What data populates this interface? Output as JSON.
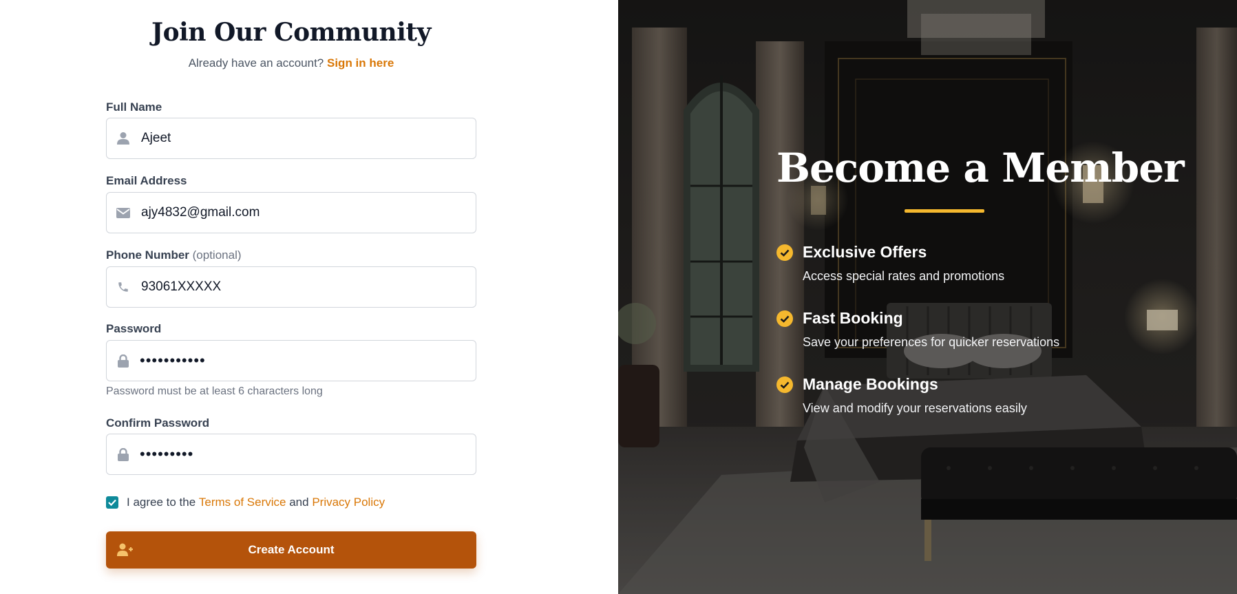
{
  "signup": {
    "title": "Join Our Community",
    "already_text": "Already have an account? ",
    "signin_link": "Sign in here"
  },
  "fields": {
    "full_name": {
      "label": "Full Name",
      "value": "Ajeet",
      "icon": "user-icon"
    },
    "email": {
      "label": "Email Address",
      "value": "ajy4832@gmail.com",
      "icon": "envelope-icon"
    },
    "phone": {
      "label": "Phone Number",
      "optional": "(optional)",
      "value": "93061XXXXX",
      "icon": "phone-icon"
    },
    "password": {
      "label": "Password",
      "value": "•••••••••••",
      "hint": "Password must be at least 6 characters long",
      "icon": "lock-icon"
    },
    "confirm_password": {
      "label": "Confirm Password",
      "value": "•••••••••",
      "icon": "lock-icon"
    }
  },
  "agreement": {
    "checked": true,
    "prefix": "I agree to the ",
    "terms": "Terms of Service",
    "and": " and ",
    "privacy": "Privacy Policy"
  },
  "create_button": {
    "label": "Create Account",
    "icon": "user-plus-icon"
  },
  "promo": {
    "headline": "Become a Member",
    "features": [
      {
        "title": "Exclusive Offers",
        "desc": "Access special rates and promotions"
      },
      {
        "title": "Fast Booking",
        "desc": "Save your preferences for quicker reservations"
      },
      {
        "title": "Manage Bookings",
        "desc": "View and modify your reservations easily"
      }
    ]
  },
  "colors": {
    "accent": "#d97706",
    "button": "#b4530b",
    "gold": "#f5b82e",
    "checkbox": "#0e8a9a"
  }
}
